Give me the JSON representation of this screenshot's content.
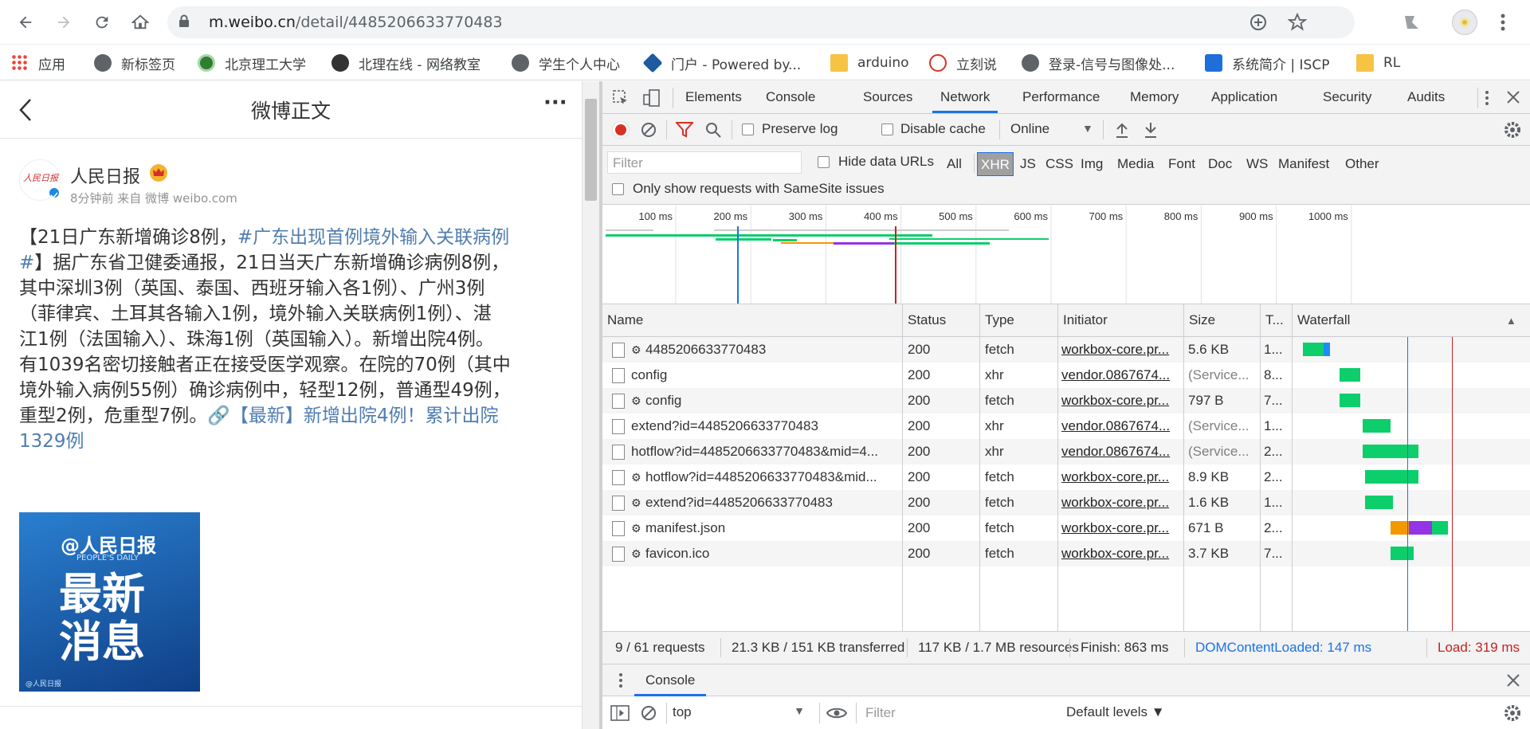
{
  "browser": {
    "url_host": "m.weibo.cn",
    "url_path": "/detail/4485206633770483",
    "bookmarks": [
      {
        "label": "应用"
      },
      {
        "label": "新标签页"
      },
      {
        "label": "北京理工大学"
      },
      {
        "label": "北理在线 - 网络教室"
      },
      {
        "label": "学生个人中心"
      },
      {
        "label": "门户 - Powered by..."
      },
      {
        "label": "arduino"
      },
      {
        "label": "立刻说"
      },
      {
        "label": "登录-信号与图像处..."
      },
      {
        "label": "系统简介 | ISCP"
      },
      {
        "label": "RL"
      }
    ]
  },
  "weibo": {
    "header_title": "微博正文",
    "more": "···",
    "author": "人民日报",
    "meta": "8分钟前 来自 微博 weibo.com",
    "avatar_text": "人民日报",
    "body_lines": [
      {
        "plain": "【21日广东新增确诊8例，",
        "link": "#广东出现首例境外输入关联病例"
      },
      {
        "plain": "",
        "link": "#",
        "tail": "】据广东省卫健委通报，21日当天广东新增确诊病例8例，"
      },
      {
        "plain": "其中深圳3例（英国、泰国、西班牙输入各1例）、广州3例"
      },
      {
        "plain": "（菲律宾、土耳其各输入1例，境外输入关联病例1例）、湛"
      },
      {
        "plain": "江1例（法国输入）、珠海1例（英国输入）。新增出院4例。"
      },
      {
        "plain": "有1039名密切接触者正在接受医学观察。在院的70例（其中"
      },
      {
        "plain": "境外输入病例55例）确诊病例中，轻型12例，普通型49例，"
      },
      {
        "plain": "重型2例，危重型7例。",
        "link": "🔗【最新】新增出院4例！累计出院"
      },
      {
        "plain": "",
        "link": "1329例"
      }
    ],
    "image": {
      "logo": "@人民日报",
      "sub": "PEOPLE'S DAILY",
      "line1": "最新",
      "line2": "消息",
      "watermark": "@人民日报",
      "bg": "#1a5fa8"
    }
  },
  "devtools": {
    "tabs": [
      "Elements",
      "Console",
      "Sources",
      "Network",
      "Performance",
      "Memory",
      "Application",
      "Security",
      "Audits"
    ],
    "active_tab": "Network",
    "toolbar": {
      "preserve_log": "Preserve log",
      "disable_cache": "Disable cache",
      "throttle": "Online"
    },
    "filter_placeholder": "Filter",
    "hide_data_urls": "Hide data URLs",
    "types": [
      "All",
      "XHR",
      "JS",
      "CSS",
      "Img",
      "Media",
      "Font",
      "Doc",
      "WS",
      "Manifest",
      "Other"
    ],
    "active_type": "XHR",
    "samesite": "Only show requests with SameSite issues",
    "timeline_ticks": [
      "100 ms",
      "200 ms",
      "300 ms",
      "400 ms",
      "500 ms",
      "600 ms",
      "700 ms",
      "800 ms",
      "900 ms",
      "1000 ms"
    ],
    "columns": [
      "Name",
      "Status",
      "Type",
      "Initiator",
      "Size",
      "T...",
      "Waterfall"
    ],
    "requests": [
      {
        "gear": true,
        "name": "4485206633770483",
        "status": "200",
        "type": "fetch",
        "initiator": "workbox-core.pr...",
        "size": "5.6 KB",
        "time": "1...",
        "w_start": 0.03,
        "w_len": 0.12,
        "w_blue": 0.03
      },
      {
        "gear": false,
        "name": "config",
        "status": "200",
        "type": "xhr",
        "initiator": "vendor.0867674...",
        "size": "(Service...",
        "size_gray": true,
        "time": "8...",
        "w_start": 0.19,
        "w_len": 0.09
      },
      {
        "gear": true,
        "name": "config",
        "status": "200",
        "type": "fetch",
        "initiator": "workbox-core.pr...",
        "size": "797 B",
        "time": "7...",
        "w_start": 0.19,
        "w_len": 0.09
      },
      {
        "gear": false,
        "name": "extend?id=4485206633770483",
        "status": "200",
        "type": "xhr",
        "initiator": "vendor.0867674...",
        "size": "(Service...",
        "size_gray": true,
        "time": "1...",
        "w_start": 0.29,
        "w_len": 0.12
      },
      {
        "gear": false,
        "name": "hotflow?id=4485206633770483&mid=4...",
        "status": "200",
        "type": "xhr",
        "initiator": "vendor.0867674...",
        "size": "(Service...",
        "size_gray": true,
        "time": "2...",
        "w_start": 0.29,
        "w_len": 0.24
      },
      {
        "gear": true,
        "name": "hotflow?id=4485206633770483&mid...",
        "status": "200",
        "type": "fetch",
        "initiator": "workbox-core.pr...",
        "size": "8.9 KB",
        "time": "2...",
        "w_start": 0.3,
        "w_len": 0.23
      },
      {
        "gear": true,
        "name": "extend?id=4485206633770483",
        "status": "200",
        "type": "fetch",
        "initiator": "workbox-core.pr...",
        "size": "1.6 KB",
        "time": "1...",
        "w_start": 0.3,
        "w_len": 0.12
      },
      {
        "gear": true,
        "name": "manifest.json",
        "status": "200",
        "type": "fetch",
        "initiator": "workbox-core.pr...",
        "size": "671 B",
        "time": "2...",
        "w_start": 0.41,
        "w_len": 0.25,
        "w_orange": 0.08,
        "w_purple": 0.1
      },
      {
        "gear": true,
        "name": "favicon.ico",
        "status": "200",
        "type": "fetch",
        "initiator": "workbox-core.pr...",
        "size": "3.7 KB",
        "time": "7...",
        "w_start": 0.41,
        "w_len": 0.1
      }
    ],
    "status_bar": {
      "requests": "9 / 61 requests",
      "transferred": "21.3 KB / 151 KB transferred",
      "resources": "117 KB / 1.7 MB resources",
      "finish": "Finish: 863 ms",
      "dcl": "DOMContentLoaded: 147 ms",
      "load": "Load: 319 ms",
      "dcl_color": "#1a73e8",
      "load_color": "#c5221f"
    },
    "drawer": {
      "title": "Console",
      "context": "top",
      "filter_placeholder": "Filter",
      "levels": "Default levels ▼"
    }
  }
}
